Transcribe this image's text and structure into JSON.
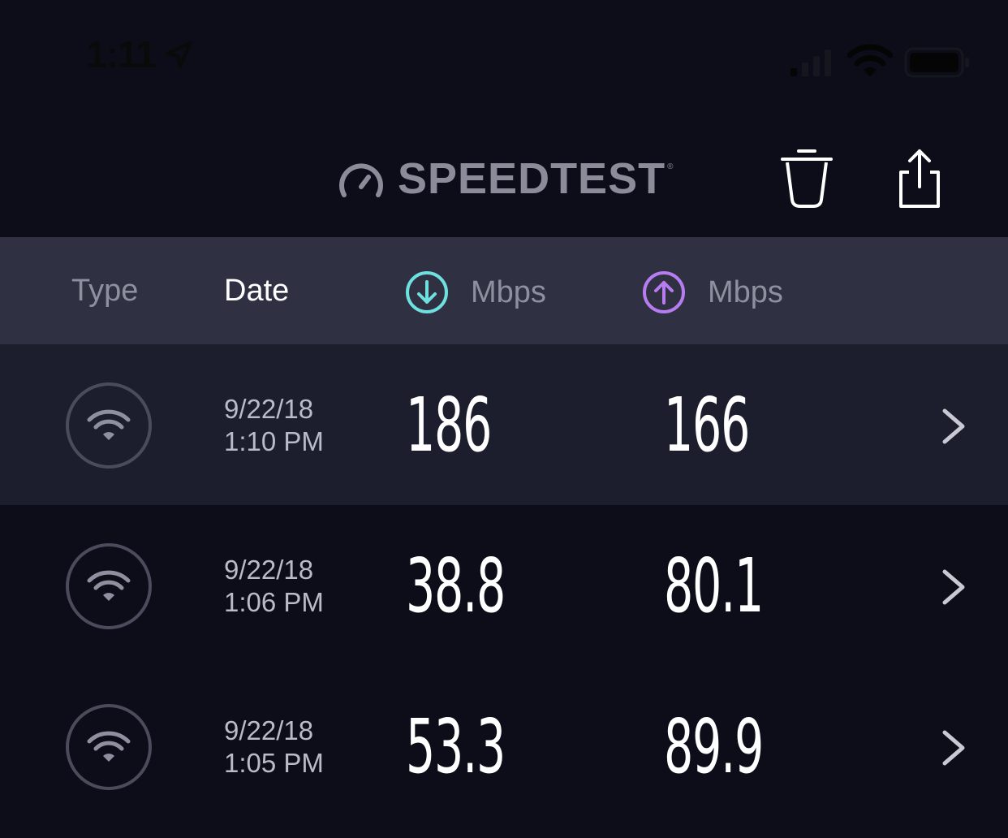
{
  "status_bar": {
    "time": "1:11",
    "icons": [
      "location-arrow-icon",
      "cellular-signal-icon",
      "wifi-icon",
      "battery-icon"
    ]
  },
  "header": {
    "brand": "SPEEDTEST",
    "trademark": "®",
    "actions": [
      "trash-icon",
      "share-icon"
    ]
  },
  "columns": {
    "type": "Type",
    "date": "Date",
    "download_unit": "Mbps",
    "upload_unit": "Mbps",
    "download_icon": "download-arrow-icon",
    "upload_icon": "upload-arrow-icon"
  },
  "results": [
    {
      "type_icon": "wifi-icon",
      "date": "9/22/18",
      "time": "1:10 PM",
      "download": "186",
      "upload": "166",
      "selected": true
    },
    {
      "type_icon": "wifi-icon",
      "date": "9/22/18",
      "time": "1:06 PM",
      "download": "38.8",
      "upload": "80.1",
      "selected": false
    },
    {
      "type_icon": "wifi-icon",
      "date": "9/22/18",
      "time": "1:05 PM",
      "download": "53.3",
      "upload": "89.9",
      "selected": false
    }
  ],
  "colors": {
    "background": "#0c0d18",
    "header_bar": "#2f3142",
    "selected_row": "#1c1e2d",
    "download_accent": "#6ee0e0",
    "upload_accent": "#b77cf0",
    "muted_text": "#8e90a0"
  }
}
